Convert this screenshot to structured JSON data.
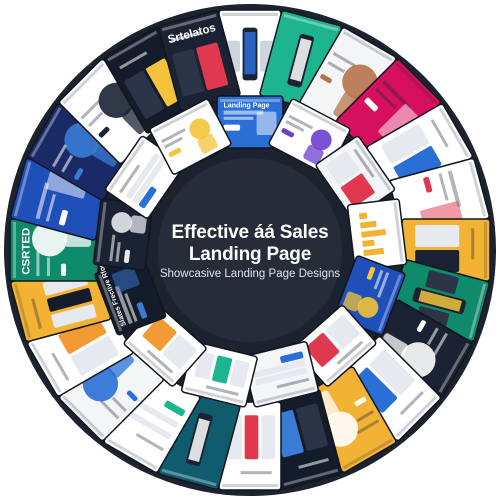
{
  "center": {
    "title_line1": "Effective áá Sales",
    "title_line2": "Landing Page",
    "subtitle": "Showcasive Landing Page Designs"
  },
  "tiles": {
    "inner": [
      {
        "bg": "#2a6fd6",
        "accent": "#ffffff",
        "label": "Landing Page",
        "kind": "light-hero"
      },
      {
        "bg": "#ffffff",
        "accent": "#6b3fd1",
        "label": "",
        "kind": "person"
      },
      {
        "bg": "#f4f5f7",
        "accent": "#e0384e",
        "label": "",
        "kind": "cards"
      },
      {
        "bg": "#ffffff",
        "accent": "#f2b233",
        "label": "",
        "kind": "chart"
      },
      {
        "bg": "#1f4fb8",
        "accent": "#f2c33b",
        "label": "",
        "kind": "person"
      },
      {
        "bg": "#ffffff",
        "accent": "#e0384e",
        "label": "",
        "kind": "cards"
      },
      {
        "bg": "#f4f5f7",
        "accent": "#2a6fd6",
        "label": "",
        "kind": "form"
      },
      {
        "bg": "#ffffff",
        "accent": "#1db58f",
        "label": "",
        "kind": "pricing"
      },
      {
        "bg": "#ffffff",
        "accent": "#f29a33",
        "label": "",
        "kind": "cards"
      },
      {
        "bg": "#141b2b",
        "accent": "#3a7bd5",
        "label": "Slates Frective Rfoe",
        "kind": "dark-hero"
      },
      {
        "bg": "#1a2233",
        "accent": "#e6e9ee",
        "label": "",
        "kind": "person"
      },
      {
        "bg": "#ffffff",
        "accent": "#2a6fd6",
        "label": "",
        "kind": "form"
      },
      {
        "bg": "#ffffff",
        "accent": "#f2c33b",
        "label": "",
        "kind": "person"
      }
    ],
    "outer": [
      {
        "bg": "#ffffff",
        "accent": "#2a6fd6",
        "label": "",
        "kind": "devices"
      },
      {
        "bg": "#1db58f",
        "accent": "#ffffff",
        "label": "",
        "kind": "phone"
      },
      {
        "bg": "#f4f5f7",
        "accent": "#b8734a",
        "label": "",
        "kind": "photo"
      },
      {
        "bg": "#d6105f",
        "accent": "#ffffff",
        "label": "",
        "kind": "dark-hero"
      },
      {
        "bg": "#ffffff",
        "accent": "#2a6fd6",
        "label": "",
        "kind": "cards"
      },
      {
        "bg": "#ffffff",
        "accent": "#e0384e",
        "label": "",
        "kind": "light-hero"
      },
      {
        "bg": "#f2b233",
        "accent": "#1a2233",
        "label": "",
        "kind": "cards"
      },
      {
        "bg": "#0f8a6b",
        "accent": "#f2c33b",
        "label": "",
        "kind": "devices"
      },
      {
        "bg": "#1a2233",
        "accent": "#ffffff",
        "label": "",
        "kind": "photo"
      },
      {
        "bg": "#ffffff",
        "accent": "#2a6fd6",
        "label": "",
        "kind": "cards"
      },
      {
        "bg": "#f2b233",
        "accent": "#ffffff",
        "label": "",
        "kind": "person"
      },
      {
        "bg": "#141b2b",
        "accent": "#3a7bd5",
        "label": "",
        "kind": "cards"
      },
      {
        "bg": "#ffffff",
        "accent": "#e0384e",
        "label": "",
        "kind": "pricing"
      },
      {
        "bg": "#0f5c6e",
        "accent": "#ffffff",
        "label": "",
        "kind": "phone"
      },
      {
        "bg": "#ffffff",
        "accent": "#1db58f",
        "label": "",
        "kind": "form"
      },
      {
        "bg": "#f4f5f7",
        "accent": "#2a6fd6",
        "label": "",
        "kind": "person"
      },
      {
        "bg": "#ffffff",
        "accent": "#f29a33",
        "label": "",
        "kind": "cards"
      },
      {
        "bg": "#f2b233",
        "accent": "#141b2b",
        "label": "",
        "kind": "pricing"
      },
      {
        "bg": "#0f8a6b",
        "accent": "#ffffff",
        "label": "CSRTED",
        "kind": "person"
      },
      {
        "bg": "#1f4fb8",
        "accent": "#ffffff",
        "label": "",
        "kind": "dark-hero"
      },
      {
        "bg": "#1a2a66",
        "accent": "#3a7bd5",
        "label": "",
        "kind": "person"
      },
      {
        "bg": "#ffffff",
        "accent": "#1a2233",
        "label": "",
        "kind": "person"
      },
      {
        "bg": "#141b2b",
        "accent": "#f2c33b",
        "label": "",
        "kind": "cards"
      },
      {
        "bg": "#1a2233",
        "accent": "#e0384e",
        "label": "Srtelatos",
        "kind": "cards"
      }
    ]
  },
  "colors": {
    "ring_background": "#1c222e",
    "center_background": "#262c38",
    "page_background": "#ffffff"
  }
}
